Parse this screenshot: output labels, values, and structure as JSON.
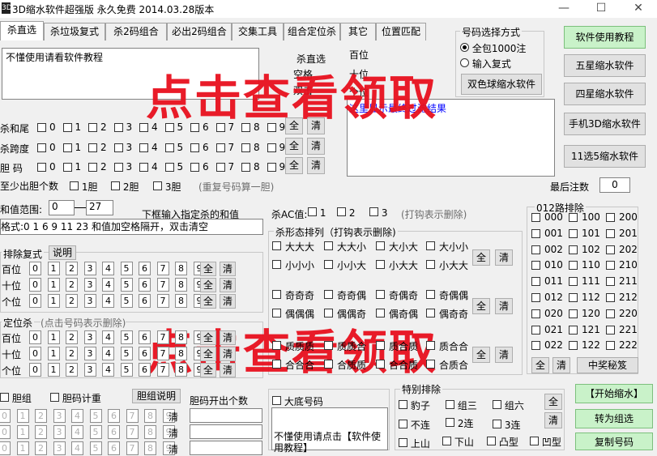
{
  "window": {
    "title": "3D缩水软件超强版  永久免费  2014.03.28版本",
    "icon": "3D",
    "minimize": "—",
    "maximize": "☐",
    "close": "✕"
  },
  "tabs": [
    "杀直选",
    "杀垃圾复式",
    "杀2码组合",
    "必出2码组合",
    "交集工具",
    "组合定位杀",
    "其它",
    "位置匹配"
  ],
  "hint_text": "不懂使用请看软件教程",
  "kill_labels": {
    "sha_zhixuan": "杀直选",
    "kong_ge": "空格",
    "shuang_ji": "双击"
  },
  "position_labels": {
    "baiwei": "百位",
    "shiwei": "十位",
    "gewei": "个位"
  },
  "number_select": {
    "title": "号码选择方式",
    "opt1": "全包1000注",
    "opt2": "输入复式",
    "dual_btn": "双色球缩水软件",
    "result_hint": "这里显示最终过滤结果"
  },
  "right_buttons": [
    "软件使用教程",
    "五星缩水软件",
    "四星缩水软件",
    "手机3D缩水软件",
    "11选5缩水软件"
  ],
  "final_count": {
    "label": "最后注数",
    "value": "0"
  },
  "digits": [
    "0",
    "1",
    "2",
    "3",
    "4",
    "5",
    "6",
    "7",
    "8",
    "9"
  ],
  "kill_rows": [
    {
      "label": "杀和尾"
    },
    {
      "label": "杀跨度"
    },
    {
      "label": "胆 码"
    }
  ],
  "all_btn": "全",
  "clear_btn": "清",
  "dan_row": {
    "label": "至少出胆个数",
    "opt1": "1胆",
    "opt2": "2胆",
    "opt3": "3胆",
    "note": "(重复号码算一胆)"
  },
  "sum_range": {
    "label": "和值范围:",
    "from": "0",
    "to": "27",
    "hint": "下框输入指定杀的和值",
    "format": "格式:0 1 6 9 11 23 和值加空格隔开，双击清空"
  },
  "ac": {
    "label": "杀AC值:",
    "o1": "1",
    "o2": "2",
    "o3": "3",
    "note": "(打钩表示删除)"
  },
  "shape": {
    "title": "杀形态排列（打钩表示删除)",
    "row1": [
      "大大大",
      "大大小",
      "大小大",
      "大小小"
    ],
    "row2": [
      "小小小",
      "小小大",
      "小大大",
      "小大大"
    ],
    "row3": [
      "奇奇奇",
      "奇奇偶",
      "奇偶奇",
      "奇偶偶"
    ],
    "row4": [
      "偶偶偶",
      "偶偶奇",
      "偶奇偶",
      "偶奇奇"
    ],
    "row5": [
      "质质质",
      "质质合",
      "质合质",
      "质合合"
    ],
    "row6": [
      "合合合",
      "合质质",
      "合合质",
      "合质合"
    ]
  },
  "paichu": {
    "title": "排除复式",
    "explain": "说明",
    "rows": [
      "百位",
      "十位",
      "个位"
    ]
  },
  "dingwei": {
    "title": "定位杀",
    "note": "(点击号码表示删除)",
    "rows": [
      "百位",
      "十位",
      "个位"
    ]
  },
  "road012": {
    "title": "012路排除",
    "items": [
      "000",
      "100",
      "200",
      "001",
      "101",
      "201",
      "002",
      "102",
      "202",
      "010",
      "110",
      "210",
      "011",
      "111",
      "211",
      "012",
      "112",
      "212",
      "020",
      "120",
      "220",
      "021",
      "121",
      "221",
      "022",
      "122",
      "222"
    ],
    "prize_btn": "中奖秘笈"
  },
  "bottom": {
    "dan": "胆组",
    "danma": "胆码计重",
    "dan_explain": "胆组说明",
    "danma_count": "胆码开出个数",
    "dadi": "大底号码",
    "dadi_text": "不懂使用请点击【软件使用教程】",
    "special": "特别排除",
    "sp_row1": [
      "豹子",
      "组三",
      "组六"
    ],
    "sp_row2": [
      "不连",
      "2连",
      "3连"
    ],
    "sp_row3": [
      "上山",
      "下山",
      "凸型",
      "凹型"
    ],
    "start": "【开始缩水】",
    "convert": "转为组选",
    "copy": "复制号码"
  },
  "watermark": "点击查看领取"
}
